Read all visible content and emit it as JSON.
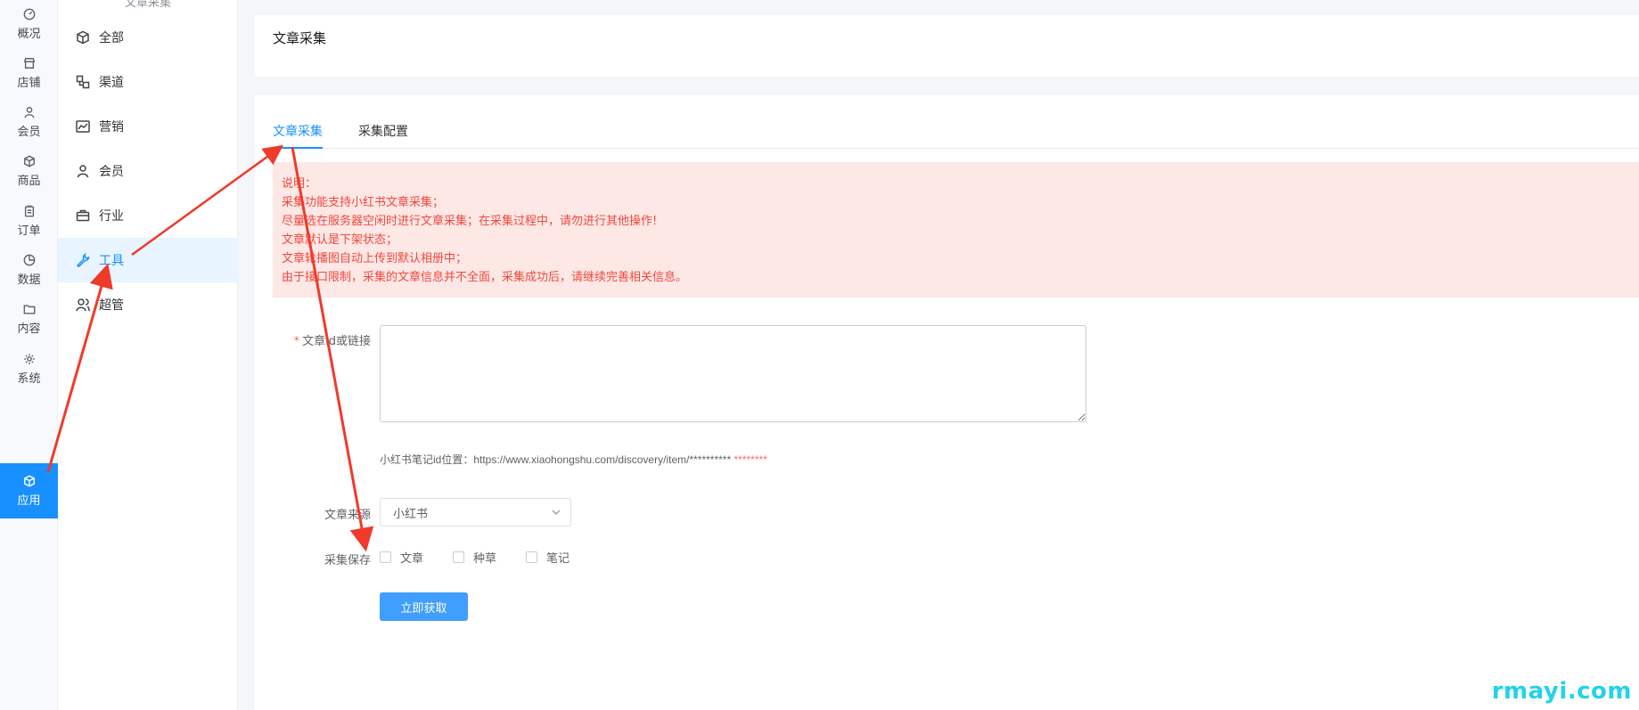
{
  "rail": {
    "items": [
      {
        "label": "概况",
        "icon": "dashboard-icon"
      },
      {
        "label": "店铺",
        "icon": "store-icon"
      },
      {
        "label": "会员",
        "icon": "user-icon"
      },
      {
        "label": "商品",
        "icon": "box-icon"
      },
      {
        "label": "订单",
        "icon": "clipboard-icon"
      },
      {
        "label": "数据",
        "icon": "pie-chart-icon"
      },
      {
        "label": "内容",
        "icon": "folder-icon"
      },
      {
        "label": "系统",
        "icon": "gear-icon"
      },
      {
        "label": "应用",
        "icon": "cube-icon",
        "active": true
      }
    ],
    "active_color": "#1890ff"
  },
  "submenu": {
    "title": "文章采集",
    "items": [
      {
        "label": "全部",
        "icon": "cube-icon"
      },
      {
        "label": "渠道",
        "icon": "channels-icon"
      },
      {
        "label": "营销",
        "icon": "line-chart-icon"
      },
      {
        "label": "会员",
        "icon": "user-icon"
      },
      {
        "label": "行业",
        "icon": "briefcase-icon"
      },
      {
        "label": "工具",
        "icon": "wrench-icon",
        "active": true
      },
      {
        "label": "超管",
        "icon": "admin-icon"
      }
    ]
  },
  "header": {
    "title": "文章采集"
  },
  "tabs": [
    {
      "label": "文章采集",
      "active": true
    },
    {
      "label": "采集配置",
      "active": false
    }
  ],
  "notice": {
    "lines": [
      "说明：",
      "采集功能支持小红书文章采集；",
      "尽量选在服务器空闲时进行文章采集；在采集过程中，请勿进行其他操作!",
      "文章默认是下架状态；",
      "文章轮播图自动上传到默认相册中；",
      "由于接口限制，采集的文章信息并不全面，采集成功后，请继续完善相关信息。"
    ],
    "bg_color": "#fde8e6",
    "text_color": "#f2473c"
  },
  "form": {
    "url_label": "文章id或链接",
    "url_required_mark": "*",
    "url_value": "",
    "hint_text": "小红书笔记id位置：https://www.xiaohongshu.com/discovery/item/**********",
    "hint_stars": "********",
    "source_label": "文章来源",
    "source_value": "小红书",
    "save_label": "采集保存",
    "save_options": [
      "文章",
      "种草",
      "笔记"
    ],
    "submit_label": "立即获取"
  },
  "watermark": "rmayi.com",
  "annotation_color": "#f03a2a"
}
